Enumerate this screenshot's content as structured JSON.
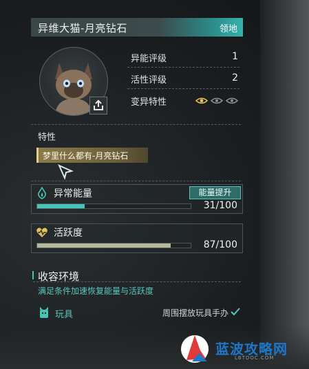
{
  "header": {
    "title": "异维大猫-月亮钻石",
    "tag": "领地"
  },
  "stats": [
    {
      "label": "异能评级",
      "value": "1"
    },
    {
      "label": "活性评级",
      "value": "2"
    },
    {
      "label": "变异特性",
      "value": ""
    }
  ],
  "mutation_icons": [
    "eye-icon-active",
    "eye-icon-inactive",
    "eye-icon-inactive"
  ],
  "traits": {
    "title": "特性",
    "items": [
      "梦里什么都有-月亮钻石"
    ]
  },
  "energy": {
    "label": "异常能量",
    "value_text": "31/100",
    "fill": 0.31,
    "button": "能量提升",
    "color": "#46c4b8"
  },
  "activity": {
    "label": "活跃度",
    "value_text": "87/100",
    "fill": 0.87,
    "color": "#b6b99a"
  },
  "environment": {
    "title": "收容环境",
    "description": "满足条件加速恢复能量与活跃度",
    "items": [
      {
        "label": "玩具",
        "condition": "周围摆放玩具手办",
        "done": true
      }
    ]
  },
  "watermark": {
    "text": "蓝波攻略网",
    "sub": "LBTDOC.COM"
  }
}
